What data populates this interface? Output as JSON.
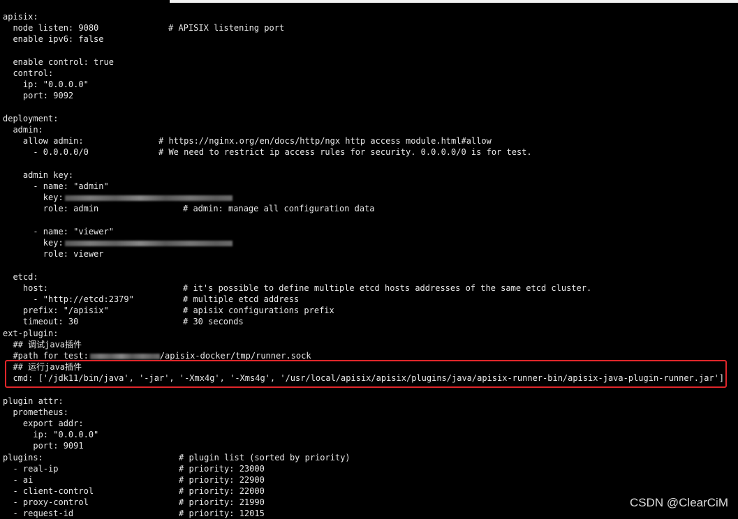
{
  "lines": {
    "l0": {
      "code": "apisix:",
      "comment": ""
    },
    "l1": {
      "code": "  node listen: 9080",
      "comment": "# APISIX listening port"
    },
    "l2": {
      "code": "  enable ipv6: false",
      "comment": ""
    },
    "l4": {
      "code": "  enable control: true",
      "comment": ""
    },
    "l5": {
      "code": "  control:",
      "comment": ""
    },
    "l6": {
      "code": "    ip: \"0.0.0.0\"",
      "comment": ""
    },
    "l7": {
      "code": "    port: 9092",
      "comment": ""
    },
    "l9": {
      "code": "deployment:",
      "comment": ""
    },
    "l10": {
      "code": "  admin:",
      "comment": ""
    },
    "l11": {
      "code": "    allow admin:",
      "comment": "# https://nginx.org/en/docs/http/ngx http access module.html#allow"
    },
    "l12": {
      "code": "      - 0.0.0.0/0",
      "comment": "# We need to restrict ip access rules for security. 0.0.0.0/0 is for test."
    },
    "l14": {
      "code": "    admin key:",
      "comment": ""
    },
    "l15": {
      "code": "      - name: \"admin\"",
      "comment": ""
    },
    "l16": {
      "code": "        key:",
      "comment": ""
    },
    "l17": {
      "code": "        role: admin",
      "comment": "# admin: manage all configuration data"
    },
    "l19": {
      "code": "      - name: \"viewer\"",
      "comment": ""
    },
    "l20": {
      "code": "        key:",
      "comment": ""
    },
    "l21": {
      "code": "        role: viewer",
      "comment": ""
    },
    "l23": {
      "code": "  etcd:",
      "comment": ""
    },
    "l24": {
      "code": "    host:",
      "comment": "# it's possible to define multiple etcd hosts addresses of the same etcd cluster."
    },
    "l25": {
      "code": "      - \"http://etcd:2379\"",
      "comment": "# multiple etcd address"
    },
    "l26": {
      "code": "    prefix: \"/apisix\"",
      "comment": "# apisix configurations prefix"
    },
    "l27": {
      "code": "    timeout: 30",
      "comment": "# 30 seconds"
    },
    "l28": {
      "code": "ext-plugin:",
      "comment": ""
    },
    "l29": {
      "code": "  ## 调试java插件",
      "comment": ""
    },
    "l30": {
      "code": "  #path for test:",
      "rest": "/apisix-docker/tmp/runner.sock"
    },
    "l31": {
      "code": "  ## 运行java插件",
      "comment": ""
    },
    "l32": {
      "code": "  cmd: ['/jdk11/bin/java', '-jar', '-Xmx4g', '-Xms4g', '/usr/local/apisix/apisix/plugins/java/apisix-runner-bin/apisix-java-plugin-runner.jar']",
      "comment": ""
    },
    "l34": {
      "code": "plugin attr:",
      "comment": ""
    },
    "l35": {
      "code": "  prometheus:",
      "comment": ""
    },
    "l36": {
      "code": "    export addr:",
      "comment": ""
    },
    "l37": {
      "code": "      ip: \"0.0.0.0\"",
      "comment": ""
    },
    "l38": {
      "code": "      port: 9091",
      "comment": ""
    },
    "l39": {
      "code": "plugins:",
      "comment": "# plugin list (sorted by priority)"
    },
    "l40": {
      "code": "  - real-ip",
      "comment": "# priority: 23000"
    },
    "l41": {
      "code": "  - ai",
      "comment": "# priority: 22900"
    },
    "l42": {
      "code": "  - client-control",
      "comment": "# priority: 22000"
    },
    "l43": {
      "code": "  - proxy-control",
      "comment": "# priority: 21990"
    },
    "l44": {
      "code": "  - request-id",
      "comment": "# priority: 12015"
    }
  },
  "watermark": "CSDN @ClearCiM",
  "colors": {
    "background": "#000000",
    "text": "#e8e8e8",
    "highlight": "#e0262a"
  }
}
